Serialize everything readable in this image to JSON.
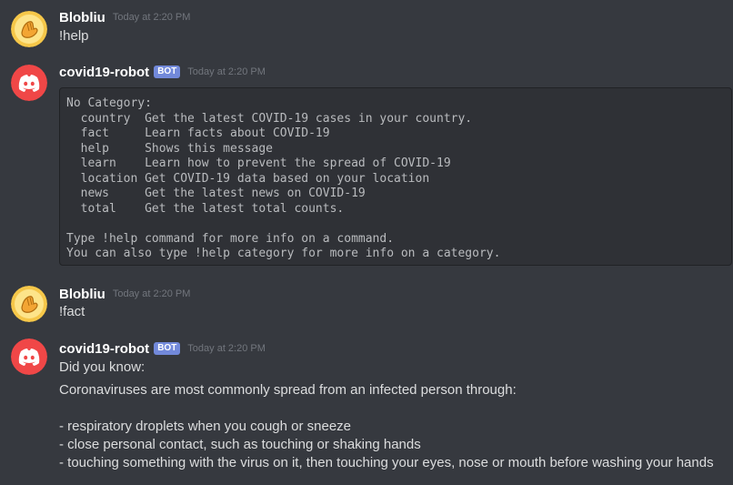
{
  "messages": [
    {
      "author": "Blobliu",
      "timestamp": "Today at 2:20 PM",
      "avatar_icon": "waving-hand-blob-icon",
      "content": "!help"
    },
    {
      "author": "covid19-robot",
      "badge": "BOT",
      "timestamp": "Today at 2:20 PM",
      "avatar_icon": "discord-logo-icon",
      "code_block": "No Category:\n  country  Get the latest COVID-19 cases in your country.\n  fact     Learn facts about COVID-19\n  help     Shows this message\n  learn    Learn how to prevent the spread of COVID-19\n  location Get COVID-19 data based on your location\n  news     Get the latest news on COVID-19\n  total    Get the latest total counts.\n\nType !help command for more info on a command.\nYou can also type !help category for more info on a category."
    },
    {
      "author": "Blobliu",
      "timestamp": "Today at 2:20 PM",
      "avatar_icon": "waving-hand-blob-icon",
      "content": "!fact"
    },
    {
      "author": "covid19-robot",
      "badge": "BOT",
      "timestamp": "Today at 2:20 PM",
      "avatar_icon": "discord-logo-icon",
      "lines": [
        "Did you know:",
        "Coronaviruses are most commonly spread from an infected person through:",
        "- respiratory droplets when you cough or sneeze",
        "- close personal contact, such as touching or shaking hands",
        "- touching something with the virus on it, then touching your eyes, nose or mouth before washing your hands"
      ]
    }
  ],
  "colors": {
    "background": "#36393f",
    "code_background": "#2f3136",
    "bot_badge": "#7289da",
    "discord_avatar": "#f04747",
    "blob_avatar": "#f6c749"
  }
}
